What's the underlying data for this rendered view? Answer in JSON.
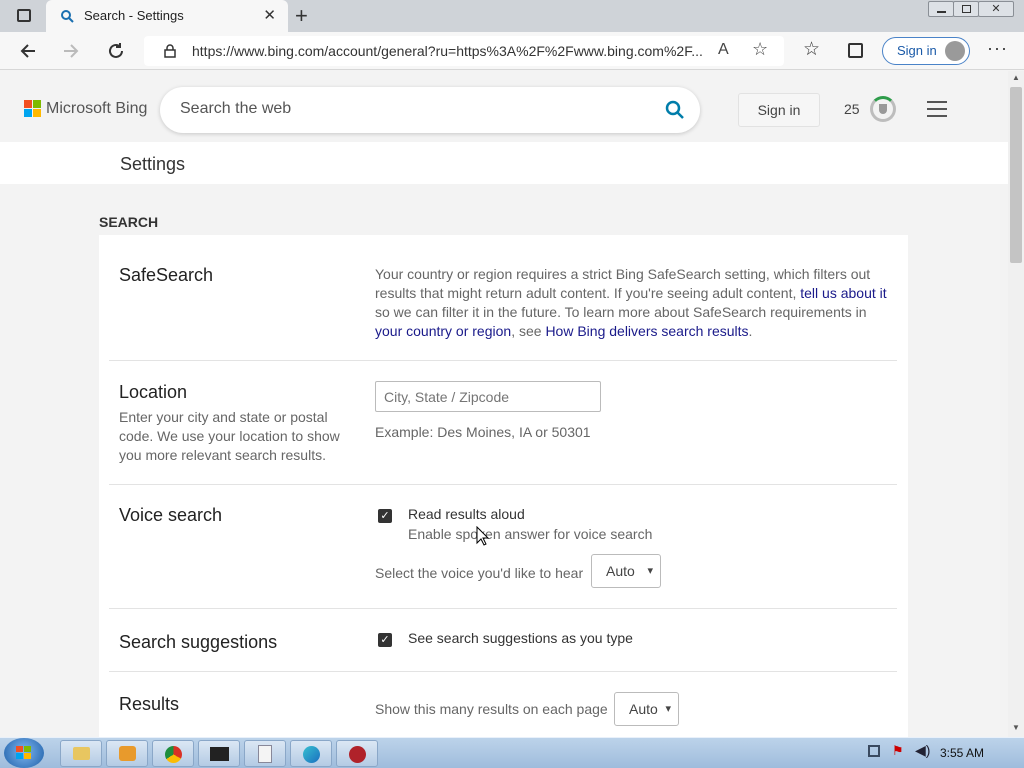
{
  "browser": {
    "tab_title": "Search - Settings",
    "url": "https://www.bing.com/account/general?ru=https%3A%2F%2Fwww.bing.com%2F...",
    "profile_signin": "Sign in"
  },
  "bing": {
    "logo_text": "Microsoft Bing",
    "search_placeholder": "Search the web",
    "signin": "Sign in",
    "rewards_points": "25"
  },
  "settings": {
    "header": "Settings",
    "section": "SEARCH",
    "safesearch": {
      "title": "SafeSearch",
      "text1": "Your country or region requires a strict Bing SafeSearch setting, which filters out results that might return adult content. If you're seeing adult content, ",
      "link1": "tell us about it",
      "text2": " so we can filter it in the future. To learn more about SafeSearch requirements in ",
      "link2": "your country or region",
      "text3": ", see ",
      "link3": "How Bing delivers search results",
      "text4": "."
    },
    "location": {
      "title": "Location",
      "description": "Enter your city and state or postal code. We use your location to show you more relevant search results.",
      "placeholder": "City, State / Zipcode",
      "example": "Example: Des Moines, IA or 50301"
    },
    "voice": {
      "title": "Voice search",
      "checkbox_label": "Read results aloud",
      "checkbox_sublabel": "Enable spoken answer for voice search",
      "checked": true,
      "voice_label": "Select the voice you'd like to hear",
      "voice_value": "Auto"
    },
    "suggestions": {
      "title": "Search suggestions",
      "checkbox_label": "See search suggestions as you type",
      "checked": true
    },
    "results": {
      "title": "Results",
      "label": "Show this many results on each page",
      "value": "Auto"
    }
  },
  "taskbar": {
    "time": "3:55 AM"
  },
  "colors": {
    "link": "#1a1a8a",
    "bing_blue": "#007daa",
    "accent": "#1a5aa8"
  }
}
